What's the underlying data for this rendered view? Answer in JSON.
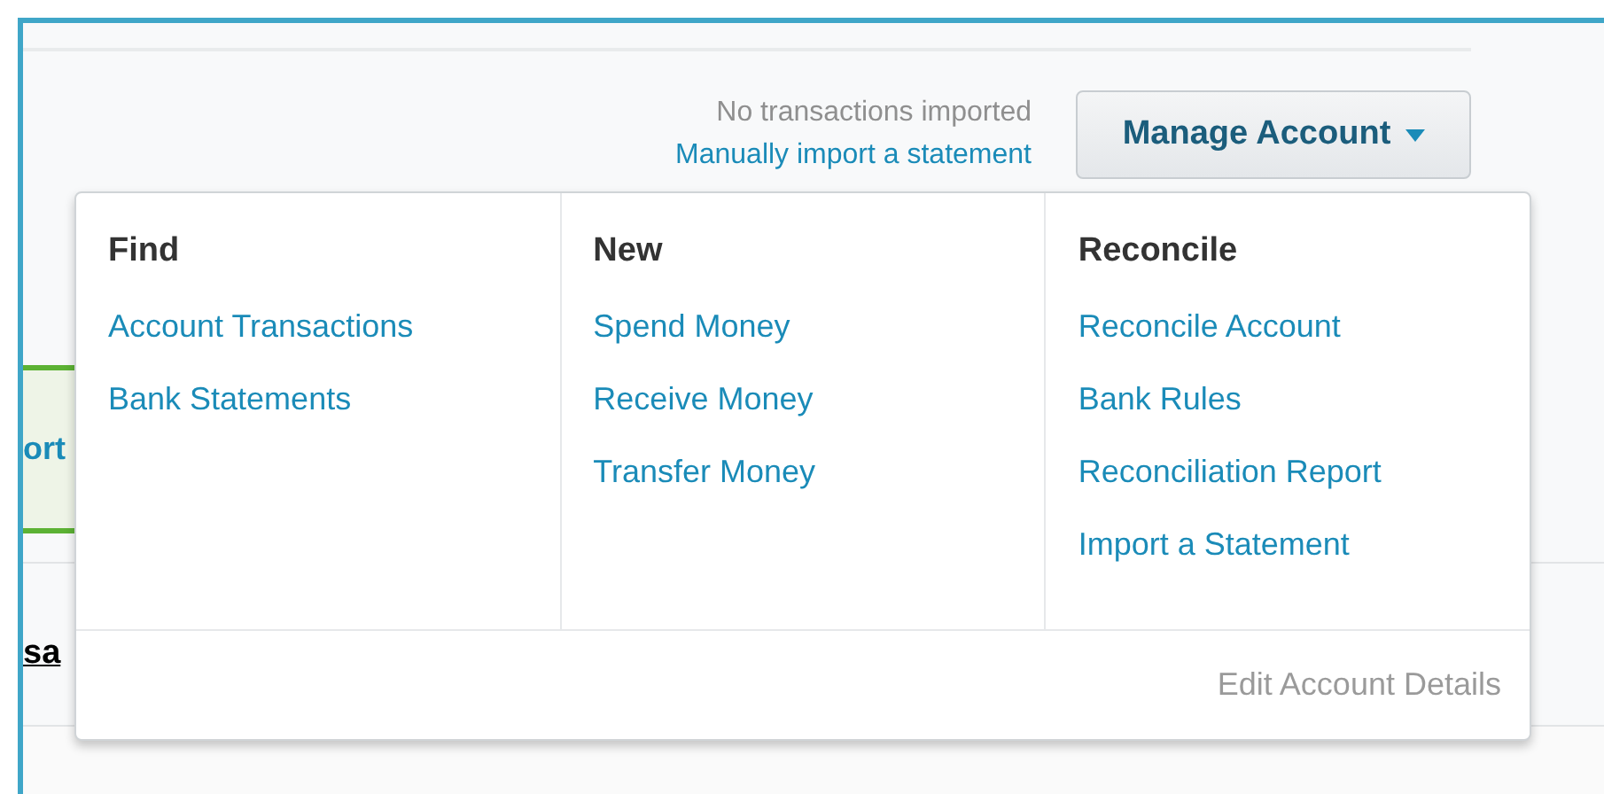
{
  "status": {
    "message": "No transactions imported",
    "link": "Manually import a statement"
  },
  "manage_button": {
    "label": "Manage Account",
    "expanded": true
  },
  "background": {
    "tab_text": "ort",
    "link_text": "sa"
  },
  "menu": {
    "columns": [
      {
        "heading": "Find",
        "items": [
          "Account Transactions",
          "Bank Statements"
        ]
      },
      {
        "heading": "New",
        "items": [
          "Spend Money",
          "Receive Money",
          "Transfer Money"
        ]
      },
      {
        "heading": "Reconcile",
        "items": [
          "Reconcile Account",
          "Bank Rules",
          "Reconciliation Report",
          "Import a Statement"
        ]
      }
    ],
    "footer": "Edit Account Details"
  }
}
